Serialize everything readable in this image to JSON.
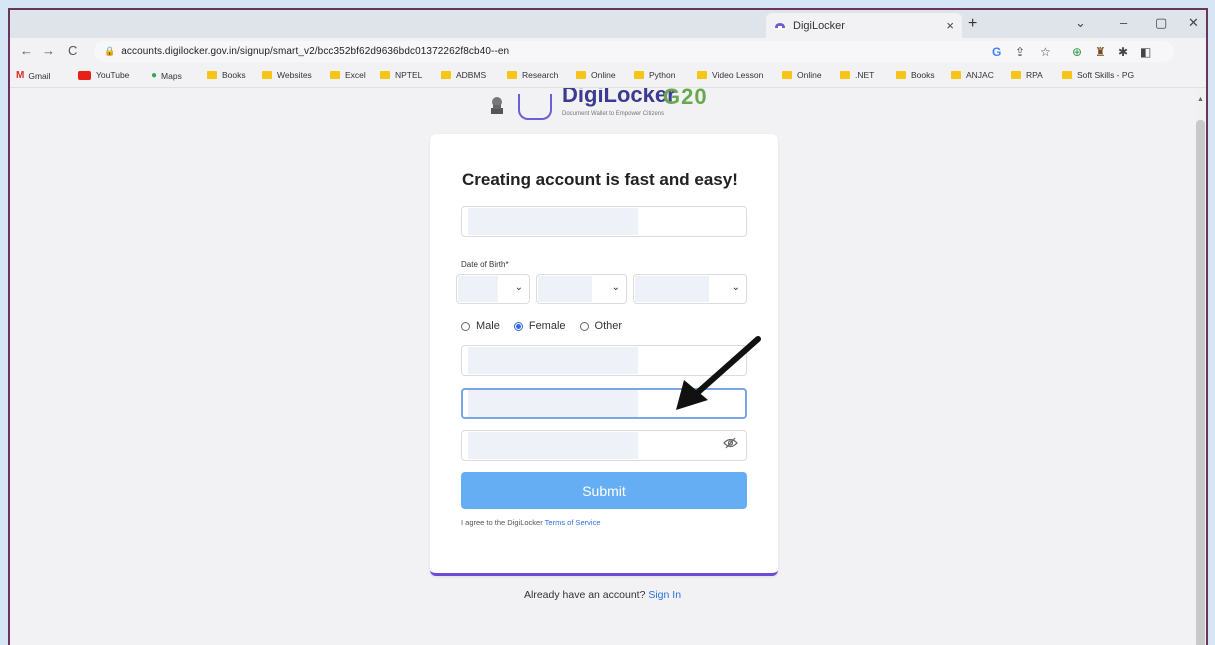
{
  "browser": {
    "tab_title": "DigiLocker",
    "tab_close": "×",
    "new_tab": "+",
    "url": "accounts.digilocker.gov.in/signup/smart_v2/bcc352bf62d9636bdc01372262f8cb40--en",
    "controls": {
      "tab_search": "⌄",
      "minimize": "–",
      "restore": "▢",
      "close": "✕"
    },
    "nav": {
      "back": "←",
      "forward": "→",
      "reload": "C"
    }
  },
  "bookmarks": [
    {
      "label": "Gmail",
      "icon": "gmail-icon"
    },
    {
      "label": "YouTube",
      "icon": "youtube-icon"
    },
    {
      "label": "Maps",
      "icon": "maps-icon"
    },
    {
      "label": "Books",
      "icon": "folder-icon"
    },
    {
      "label": "Websites",
      "icon": "folder-icon"
    },
    {
      "label": "Excel",
      "icon": "folder-icon"
    },
    {
      "label": "NPTEL",
      "icon": "folder-icon"
    },
    {
      "label": "ADBMS",
      "icon": "folder-icon"
    },
    {
      "label": "Research",
      "icon": "folder-icon"
    },
    {
      "label": "Online",
      "icon": "folder-icon"
    },
    {
      "label": "Python",
      "icon": "folder-icon"
    },
    {
      "label": "Video Lesson",
      "icon": "folder-icon"
    },
    {
      "label": "Online",
      "icon": "folder-icon"
    },
    {
      "label": ".NET",
      "icon": "folder-icon"
    },
    {
      "label": "Books",
      "icon": "folder-icon"
    },
    {
      "label": "ANJAC",
      "icon": "folder-icon"
    },
    {
      "label": "RPA",
      "icon": "folder-icon"
    },
    {
      "label": "Soft Skills - PG",
      "icon": "folder-icon"
    }
  ],
  "logo": {
    "wordmark": "DigiLocker",
    "tagline": "Document Wallet to Empower Citizens",
    "g20": "G20"
  },
  "form": {
    "title": "Creating account is fast and easy!",
    "dob_label": "Date of Birth*",
    "gender_options": [
      {
        "label": "Male",
        "selected": false
      },
      {
        "label": "Female",
        "selected": true
      },
      {
        "label": "Other",
        "selected": false
      }
    ],
    "submit_label": "Submit",
    "agree_text": "I agree to the DigiLocker ",
    "terms_link": "Terms of Service"
  },
  "footer": {
    "already_text": "Already have an account? ",
    "signin_link": "Sign In"
  },
  "colors": {
    "submit": "#66aef3",
    "link": "#2d6fe0",
    "card_accent": "#6b4bd8"
  }
}
